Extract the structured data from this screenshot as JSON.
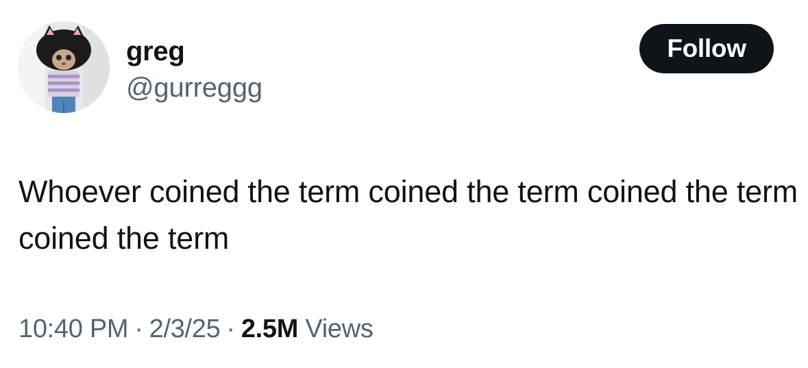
{
  "author": {
    "display_name": "greg",
    "handle": "@gurreggg",
    "avatar_icon": "cat-in-striped-sweater-avatar"
  },
  "follow_button": {
    "label": "Follow"
  },
  "tweet": {
    "text": "Whoever coined the term coined the term coined the term coined the term"
  },
  "meta": {
    "time": "10:40 PM",
    "separator": "·",
    "date": "2/3/25",
    "views_count": "2.5M",
    "views_label": "Views"
  },
  "colors": {
    "text_primary": "#0f1419",
    "text_secondary": "#536471",
    "button_bg": "#0f1419",
    "button_text": "#ffffff",
    "background": "#ffffff"
  }
}
